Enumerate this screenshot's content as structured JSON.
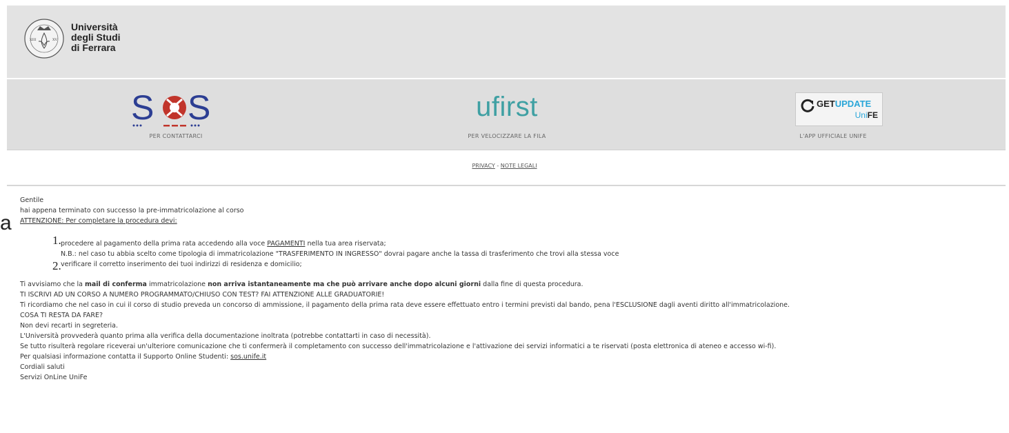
{
  "edge_fragment": "a",
  "header": {
    "university_lines": [
      "Università",
      "degli Studi",
      "di Ferrara"
    ],
    "seal_numerals": [
      "XIII",
      "XV"
    ]
  },
  "logos": {
    "sos": {
      "letters": [
        "S",
        "S"
      ],
      "caption": "PER CONTATTARCI"
    },
    "ufirst": {
      "text": "ufirst",
      "caption": "PER VELOCIZZARE LA FILA"
    },
    "getupdate": {
      "title_a": "GET",
      "title_b": "UPDATE",
      "sub_a": "Uni",
      "sub_b": "FE",
      "caption": "L'APP UFFICIALE UNIFE"
    }
  },
  "footer_links": {
    "privacy": "PRIVACY",
    "separator": " - ",
    "legal": "NOTE LEGALI"
  },
  "body": {
    "greeting": "Gentile",
    "line_success": "hai appena terminato con successo la pre-immatricolazione al corso",
    "attention": "ATTENZIONE: Per completare la procedura devi:",
    "steps": [
      {
        "num": "1.",
        "pre": "procedere al pagamento della prima rata accedendo alla voce ",
        "link": "PAGAMENTI",
        "post": " nella tua area riservata;",
        "note": "N.B.: nel caso tu abbia scelto come tipologia di immatricolazione \"TRASFERIMENTO IN INGRESSO\" dovrai pagare anche la tassa di trasferimento che trovi alla stessa voce"
      },
      {
        "num": "2.",
        "text": "verificare il corretto inserimento dei tuoi indirizzi di residenza e domicilio;"
      }
    ],
    "notice": {
      "a": "Ti avvisiamo che la ",
      "b": "mail di conferma",
      "c": " immatricolazione ",
      "d": "non arriva istantaneamente ma che può arrivare anche dopo alcuni giorni",
      "e": " dalla fine di questa procedura."
    },
    "lines": [
      "TI ISCRIVI AD UN CORSO A NUMERO PROGRAMMATO/CHIUSO CON TEST? FAI ATTENZIONE ALLE GRADUATORIE!",
      "Ti ricordiamo che nel caso in cui il corso di studio preveda un concorso di ammissione, il pagamento della prima rata deve essere effettuato entro i termini previsti dal bando, pena l'ESCLUSIONE dagli aventi diritto all'immatricolazione.",
      "COSA TI RESTA DA FARE?",
      "Non devi recarti in segreteria.",
      "L'Università provvederà quanto prima alla verifica della documentazione inoltrata (potrebbe contattarti in caso di necessità).",
      "Se tutto risulterà regolare riceverai un'ulteriore comunicazione che ti confermerà il completamento con successo dell'immatricolazione e l'attivazione dei servizi informatici a te riservati (posta elettronica di ateneo e accesso wi-fi)."
    ],
    "support_pre": "Per qualsiasi informazione contatta il Supporto Online Studenti: ",
    "support_link": "sos.unife.it",
    "closing": "Cordiali saluti",
    "signature": "Servizi OnLine UniFe"
  },
  "colors": {
    "sos_red": "#c1352b",
    "sos_blue": "#2c3e93",
    "ufirst_teal": "#3fa0a3",
    "getupdate_blue": "#2aa6d8",
    "header_bg": "#e3e3e3"
  }
}
